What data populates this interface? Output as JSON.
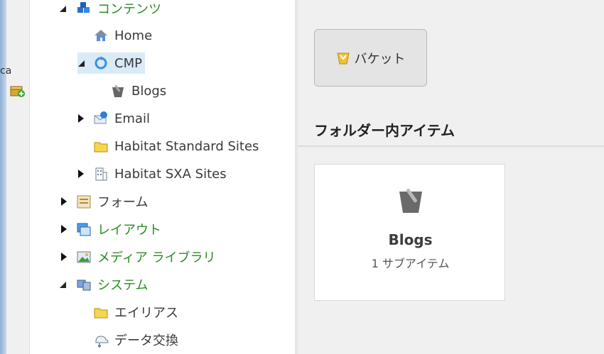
{
  "gutter": {
    "text": "ca"
  },
  "tree": {
    "items": [
      {
        "label": "コンテンツ",
        "icon": "content-icon"
      },
      {
        "label": "Home",
        "icon": "home-icon"
      },
      {
        "label": "CMP",
        "icon": "cmp-sync-icon"
      },
      {
        "label": "Blogs",
        "icon": "bucket-icon"
      },
      {
        "label": "Email",
        "icon": "email-icon"
      },
      {
        "label": "Habitat Standard Sites",
        "icon": "folder-icon"
      },
      {
        "label": "Habitat SXA Sites",
        "icon": "building-icon"
      },
      {
        "label": "フォーム",
        "icon": "form-icon"
      },
      {
        "label": "レイアウト",
        "icon": "layout-icon"
      },
      {
        "label": "メディア ライブラリ",
        "icon": "media-library-icon"
      },
      {
        "label": "システム",
        "icon": "system-icon"
      },
      {
        "label": "エイリアス",
        "icon": "folder-icon"
      },
      {
        "label": "データ交換",
        "icon": "data-exchange-icon"
      }
    ]
  },
  "content": {
    "bucket_button_label": "バケット",
    "section_title": "フォルダー内アイテム",
    "card": {
      "title": "Blogs",
      "subtitle": "1 サブアイテム"
    }
  },
  "colors": {
    "green_label": "#2a8c25",
    "selection": "#d8ebf7"
  }
}
